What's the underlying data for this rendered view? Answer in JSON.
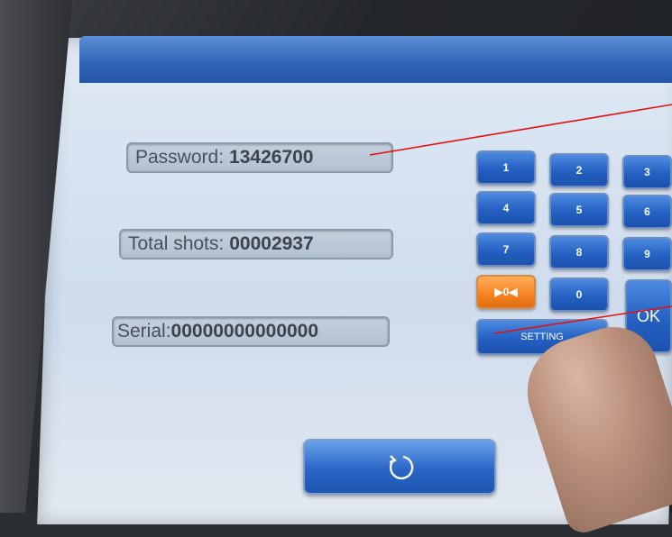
{
  "fields": {
    "password": {
      "label": "Password:",
      "value": "13426700"
    },
    "total_shots": {
      "label": "Total shots:",
      "value": "00002937"
    },
    "serial": {
      "label": "Serial:",
      "value": "00000000000000"
    }
  },
  "keypad": {
    "k1": "1",
    "k2": "2",
    "k3": "3",
    "k4": "4",
    "k5": "5",
    "k6": "6",
    "k7": "7",
    "k8": "8",
    "k9": "9",
    "k0": "0",
    "backspace": "▶0◀",
    "ok": "OK",
    "setting": "SETTING"
  },
  "refresh_icon": "refresh-icon",
  "colors": {
    "key_blue": "#2461c2",
    "key_orange": "#f58220",
    "annotation_red": "#e01010"
  }
}
